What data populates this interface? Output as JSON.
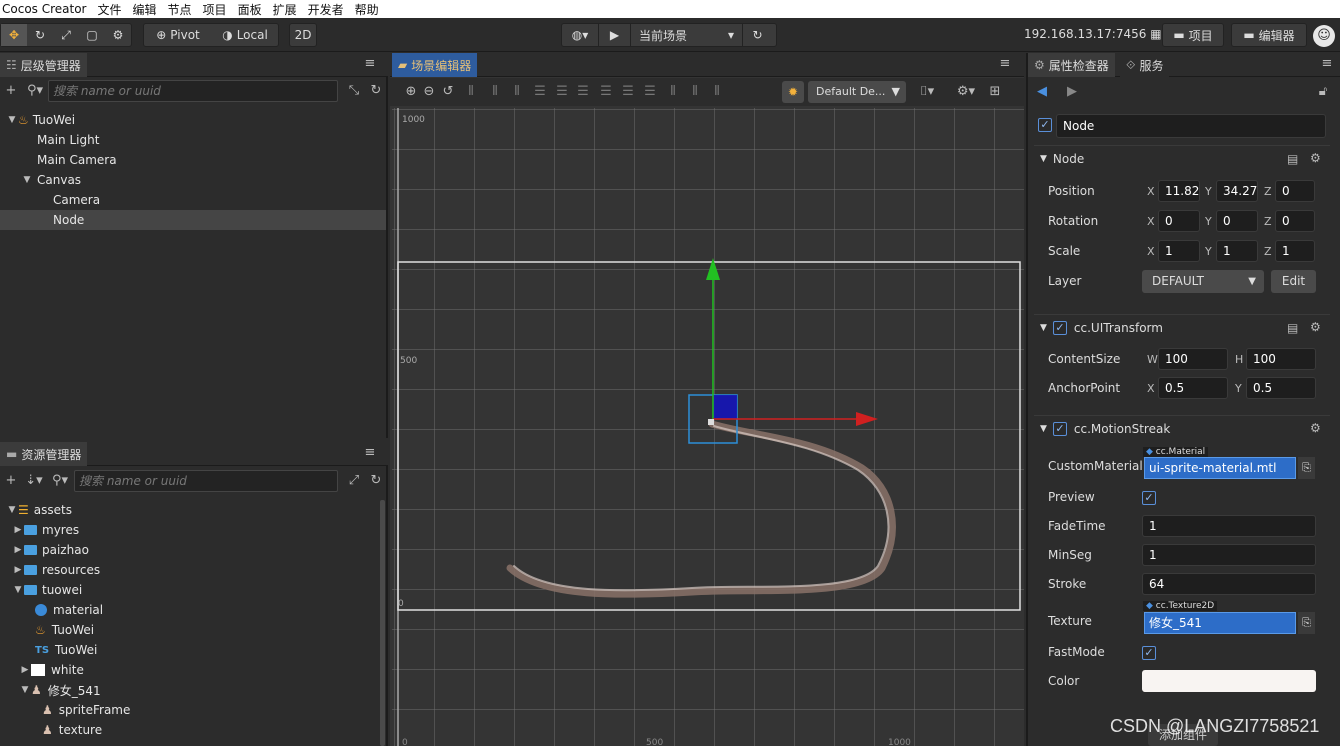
{
  "menubar": {
    "items": [
      "Cocos Creator",
      "文件",
      "编辑",
      "节点",
      "项目",
      "面板",
      "扩展",
      "开发者",
      "帮助"
    ]
  },
  "toolbar": {
    "pivot_label": "Pivot",
    "local_label": "Local",
    "mode_2d_label": "2D",
    "scene_select_label": "当前场景",
    "ip_address": "192.168.13.17:7456",
    "project_button": "项目",
    "editor_button": "编辑器"
  },
  "hierarchy": {
    "tab_label": "层级管理器",
    "search_placeholder": "搜索 name or uuid",
    "nodes": [
      "TuoWei",
      "Main Light",
      "Main Camera",
      "Canvas",
      "Camera",
      "Node"
    ],
    "selected": "Node"
  },
  "assets": {
    "tab_label": "资源管理器",
    "search_placeholder": "搜索 name or uuid",
    "items": [
      "assets",
      "myres",
      "paizhao",
      "resources",
      "tuowei",
      "material",
      "TuoWei",
      "TuoWei",
      "white",
      "修女_541",
      "spriteFrame",
      "texture"
    ],
    "ts_badge": "TS"
  },
  "scene": {
    "tab_label": "场景编辑器",
    "dropdown_label": "Default De...",
    "ruler_labels": [
      "1000",
      "500",
      "0"
    ],
    "bottom_labels": [
      "0",
      "500",
      "1000"
    ]
  },
  "inspector": {
    "tab_label": "属性检查器",
    "tab_service": "服务",
    "node_name": "Node",
    "node_section": "Node",
    "position": {
      "label": "Position",
      "x": "11.822",
      "y": "34.279",
      "z": "0"
    },
    "rotation": {
      "label": "Rotation",
      "x": "0",
      "y": "0",
      "z": "0"
    },
    "scale": {
      "label": "Scale",
      "x": "1",
      "y": "1",
      "z": "1"
    },
    "layer": {
      "label": "Layer",
      "value": "DEFAULT",
      "edit": "Edit"
    },
    "axis_x": "X",
    "axis_y": "Y",
    "axis_z": "Z",
    "axis_w": "W",
    "axis_h": "H",
    "uitransform": {
      "title": "cc.UITransform",
      "content_size_label": "ContentSize",
      "w": "100",
      "h": "100",
      "anchor_label": "AnchorPoint",
      "ax": "0.5",
      "ay": "0.5"
    },
    "motionstreak": {
      "title": "cc.MotionStreak",
      "custom_material_label": "CustomMaterial",
      "material_type": "cc.Material",
      "material_value": "ui-sprite-material.mtl",
      "preview_label": "Preview",
      "fadetime_label": "FadeTime",
      "fadetime": "1",
      "minseg_label": "MinSeg",
      "minseg": "1",
      "stroke_label": "Stroke",
      "stroke": "64",
      "texture_label": "Texture",
      "texture_type": "cc.Texture2D",
      "texture_value": "修女_541",
      "fastmode_label": "FastMode",
      "color_label": "Color",
      "color_value": "#f8f4f2"
    },
    "add_component": "添加组件"
  },
  "watermark": "CSDN @LANGZI7758521",
  "colors": {
    "accent_orange": "#f4b23c",
    "selection_blue": "#2d6dc8",
    "tab_blue": "#2e5c9e"
  }
}
